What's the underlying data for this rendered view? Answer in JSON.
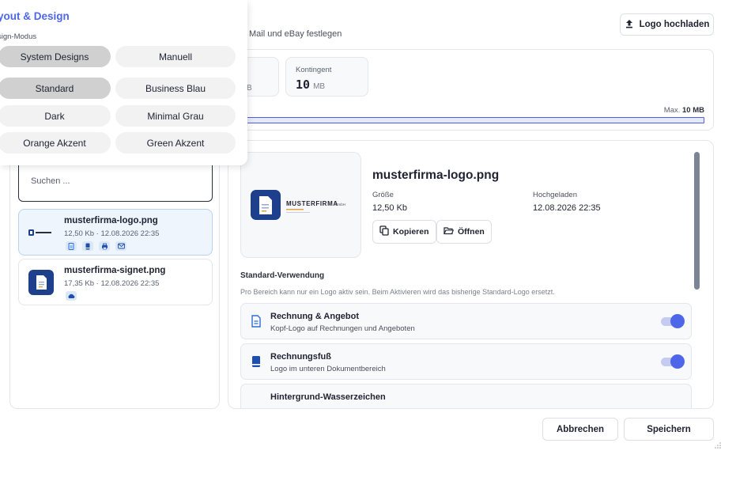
{
  "header": {
    "subtitle": "Mail und eBay festlegen",
    "upload_label": "Logo hochladen"
  },
  "storage": {
    "used_unit": "B",
    "quota_label": "Kontingent",
    "quota_value": "10",
    "quota_unit": "MB",
    "max_label": "Max.",
    "max_value": "10 MB",
    "used_fraction": 1.0
  },
  "design_popup": {
    "title": "yout & Design",
    "mode_label": "sign-Modus",
    "modes": [
      "System Designs",
      "Manuell"
    ],
    "selected_mode": "System Designs",
    "themes": [
      "Standard",
      "Business Blau",
      "Dark",
      "Minimal Grau",
      "Orange Akzent",
      "Green Akzent"
    ],
    "selected_theme": "Standard"
  },
  "logo_list": {
    "search_placeholder": "Suchen ...",
    "items": [
      {
        "name": "musterfirma-logo.png",
        "meta": "12,50 Kb · 12.08.2026 22:35",
        "active": true
      },
      {
        "name": "musterfirma-signet.png",
        "meta": "17,35 Kb · 12.08.2026 22:35",
        "active": false
      }
    ]
  },
  "detail": {
    "filename": "musterfirma-logo.png",
    "size_label": "Größe",
    "size_value": "12,50 Kb",
    "uploaded_label": "Hochgeladen",
    "uploaded_value": "12.08.2026 22:35",
    "copy_label": "Kopieren",
    "open_label": "Öffnen",
    "preview_brand": "MUSTERFIRMA",
    "preview_suffix": "GmbH",
    "usage_title": "Standard-Verwendung",
    "usage_hint": "Pro Bereich kann nur ein Logo aktiv sein. Beim Aktivieren wird das bisherige Standard-Logo ersetzt.",
    "usages": [
      {
        "name": "Rechnung & Angebot",
        "desc": "Kopf-Logo auf Rechnungen und Angeboten",
        "on": true
      },
      {
        "name": "Rechnungsfuß",
        "desc": "Logo im unteren Dokumentbereich",
        "on": true
      },
      {
        "name": "Hintergrund-Wasserzeichen",
        "desc": "",
        "on": false
      }
    ]
  },
  "footer": {
    "cancel_label": "Abbrechen",
    "save_label": "Speichern"
  },
  "colors": {
    "accent": "#4d67e8",
    "selected_pill": "#d0d0d0",
    "active_item_bg": "#eef5fd"
  }
}
